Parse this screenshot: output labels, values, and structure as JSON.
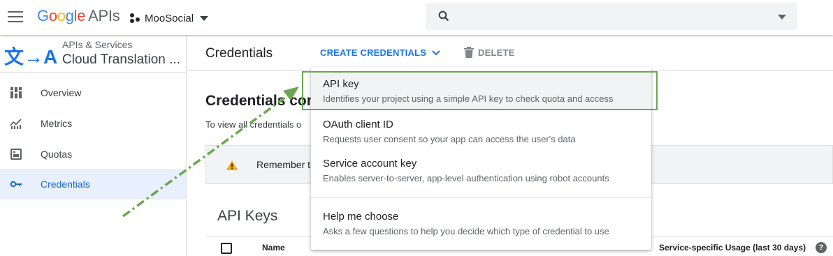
{
  "topbar": {
    "logo": {
      "g1": "G",
      "g2": "o",
      "g3": "o",
      "g4": "g",
      "g5": "l",
      "g6": "e",
      "apis": "APIs"
    },
    "project_name": "MooSocial",
    "search_placeholder": ""
  },
  "sidebar": {
    "breadcrumb": "APIs & Services",
    "api_title": "Cloud Translation ...",
    "api_icon_text": "文→A",
    "items": [
      {
        "label": "Overview",
        "icon": "dashboard-icon"
      },
      {
        "label": "Metrics",
        "icon": "metrics-icon"
      },
      {
        "label": "Quotas",
        "icon": "quotas-icon"
      },
      {
        "label": "Credentials",
        "icon": "key-icon",
        "active": true
      }
    ]
  },
  "main": {
    "title": "Credentials",
    "create_label": "CREATE CREDENTIALS",
    "delete_label": "DELETE",
    "heading": "Credentials com",
    "description": "To view all credentials o",
    "notice": "Remember t",
    "api_keys_title": "API Keys",
    "table": {
      "col_name": "Name",
      "col_usage": "Service-specific Usage (last 30 days)",
      "help": "?"
    }
  },
  "menu": {
    "items": [
      {
        "title": "API key",
        "desc": "Identifies your project using a simple API key to check quota and access"
      },
      {
        "title": "OAuth client ID",
        "desc": "Requests user consent so your app can access the user's data"
      },
      {
        "title": "Service account key",
        "desc": "Enables server-to-server, app-level authentication using robot accounts"
      },
      {
        "title": "Help me choose",
        "desc": "Asks a few questions to help you decide which type of credential to use"
      }
    ]
  },
  "colors": {
    "accent": "#1a73e8",
    "annotation": "#6aa84f",
    "active_bg": "#e8f0fe"
  }
}
